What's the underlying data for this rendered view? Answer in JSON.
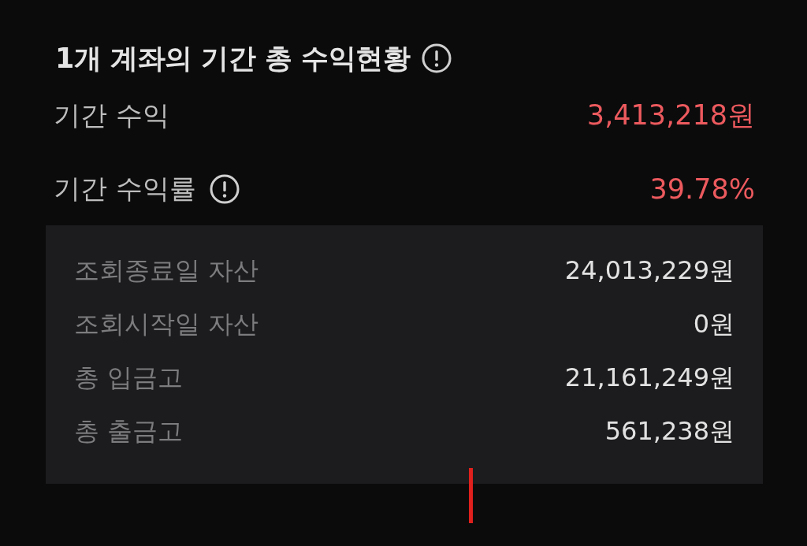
{
  "title": {
    "text": "1개 계좌의 기간 총 수익현황",
    "info": true
  },
  "summary": [
    {
      "label": "기간 수익",
      "info": false,
      "value": "3,413,218원"
    },
    {
      "label": "기간 수익률",
      "info": true,
      "value": "39.78%"
    }
  ],
  "details": [
    {
      "label": "조회종료일 자산",
      "value": "24,013,229원"
    },
    {
      "label": "조회시작일 자산",
      "value": "0원"
    },
    {
      "label": "총 입금고",
      "value": "21,161,249원"
    },
    {
      "label": "총 출금고",
      "value": "561,238원"
    }
  ]
}
